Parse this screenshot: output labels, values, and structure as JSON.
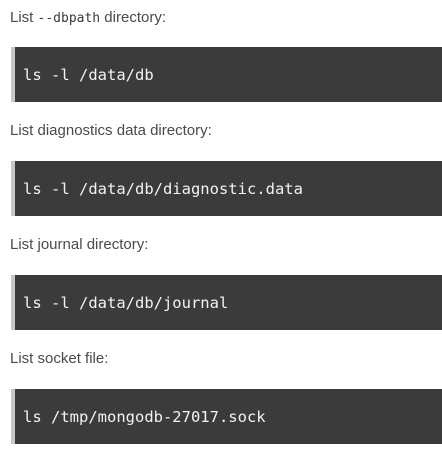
{
  "sections": [
    {
      "label_prefix": "List ",
      "label_code": "--dbpath",
      "label_suffix": " directory:",
      "command": "ls -l /data/db"
    },
    {
      "label": "List diagnostics data directory:",
      "command": "ls -l /data/db/diagnostic.data"
    },
    {
      "label": "List journal directory:",
      "command": "ls -l /data/db/journal"
    },
    {
      "label": "List socket file:",
      "command": "ls /tmp/mongodb-27017.sock"
    }
  ]
}
